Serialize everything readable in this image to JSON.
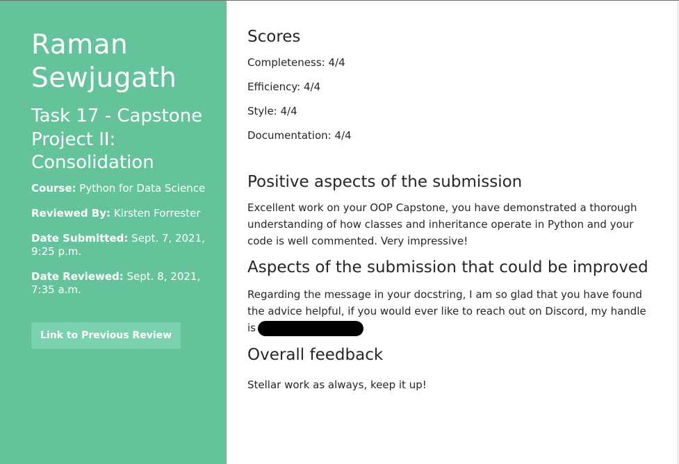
{
  "sidebar": {
    "student_name": "Raman Sewjugath",
    "task_title": "Task 17 - Capstone Project II: Consolidation",
    "course_label": "Course:",
    "course_value": "Python for Data Science",
    "reviewed_by_label": "Reviewed By:",
    "reviewed_by_value": "Kirsten Forrester",
    "date_submitted_label": "Date Submitted:",
    "date_submitted_value": "Sept. 7, 2021, 9:25 p.m.",
    "date_reviewed_label": "Date Reviewed:",
    "date_reviewed_value": "Sept. 8, 2021, 7:35 a.m.",
    "previous_review_link": "Link to Previous Review"
  },
  "main": {
    "scores_heading": "Scores",
    "scores": [
      "Completeness: 4/4",
      "Efficiency: 4/4",
      "Style: 4/4",
      "Documentation: 4/4"
    ],
    "positive_heading": "Positive aspects of the submission",
    "positive_text": "Excellent work on your OOP Capstone, you have demonstrated a thorough understanding of how classes and inheritance operate in Python and your code is well commented. Very impressive!",
    "improve_heading": "Aspects of the submission that could be improved",
    "improve_text": "Regarding the message in your docstring, I am so glad that you have found the advice helpful, if you would ever like to reach out on Discord, my handle is",
    "overall_heading": "Overall feedback",
    "overall_text": "Stellar work as always, keep it up!"
  },
  "colors": {
    "sidebar_bg": "#64c39a",
    "button_bg": "#79d2ad",
    "text_dark": "#262626",
    "redaction": "#000000"
  }
}
